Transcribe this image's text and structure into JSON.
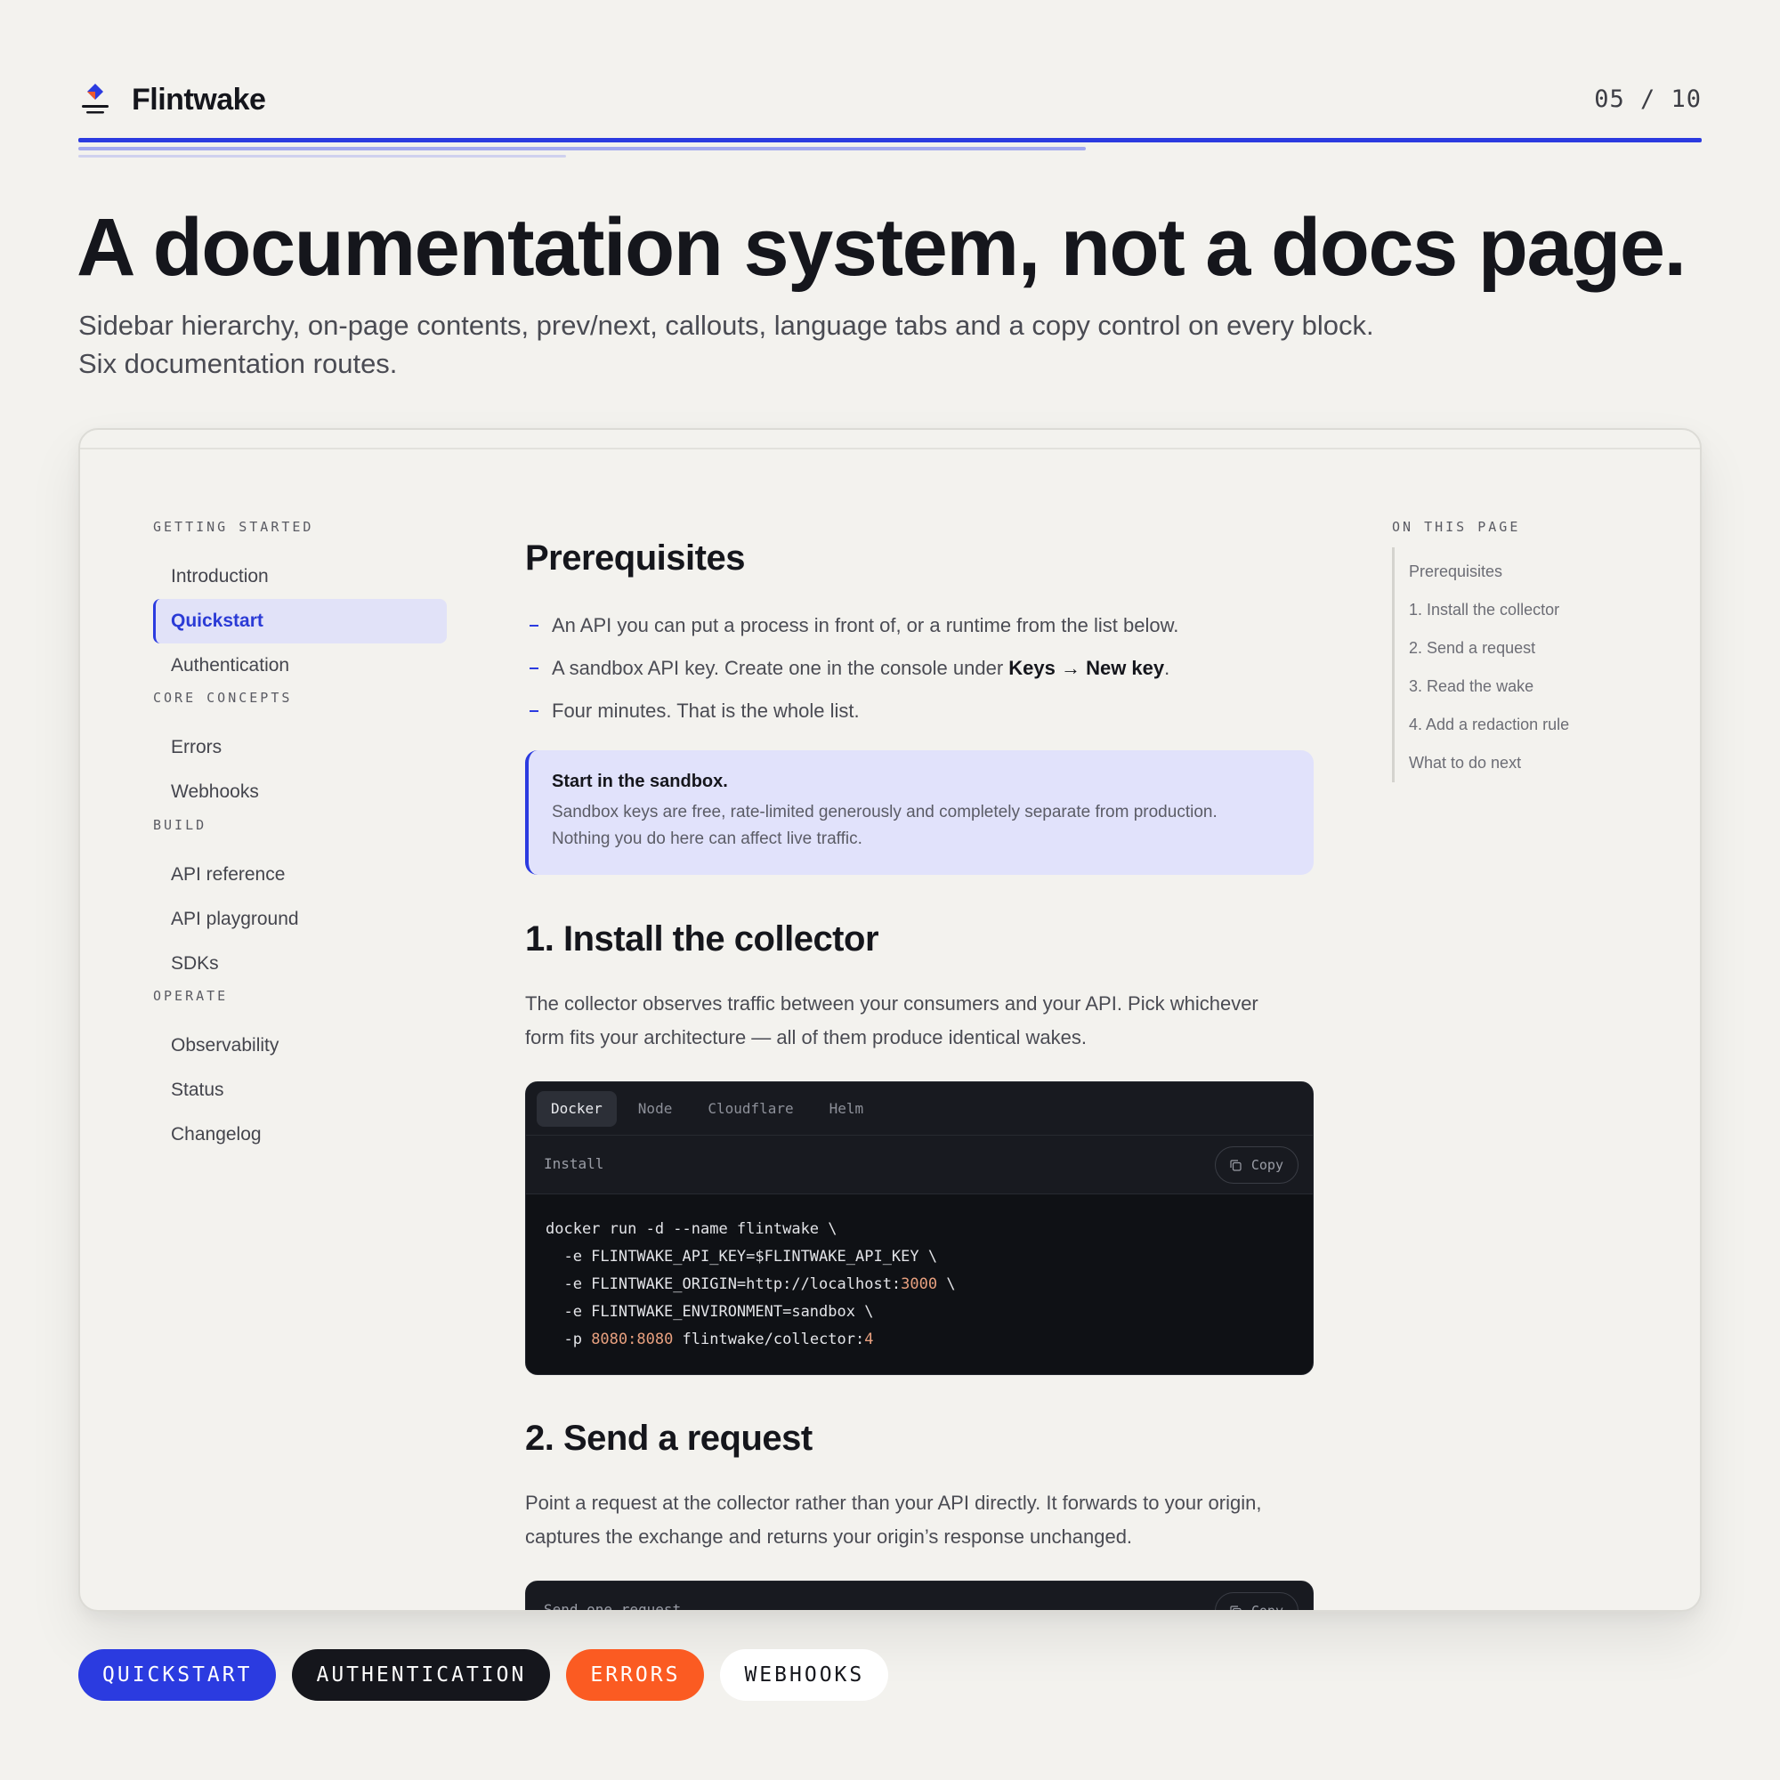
{
  "brand": {
    "name": "Flintwake"
  },
  "pager": "05 / 10",
  "hero": {
    "title": "A documentation system, not a docs page.",
    "subtitle_line1": "Sidebar hierarchy, on-page contents, prev/next, callouts, language tabs and a copy control on every block.",
    "subtitle_line2": "Six documentation routes."
  },
  "sidebar": {
    "groups": [
      {
        "title": "GETTING STARTED",
        "items": [
          "Introduction",
          "Quickstart",
          "Authentication"
        ]
      },
      {
        "title": "CORE CONCEPTS",
        "items": [
          "Errors",
          "Webhooks"
        ]
      },
      {
        "title": "BUILD",
        "items": [
          "API reference",
          "API playground",
          "SDKs"
        ]
      },
      {
        "title": "OPERATE",
        "items": [
          "Observability",
          "Status",
          "Changelog"
        ]
      }
    ],
    "active": "Quickstart"
  },
  "content": {
    "prereq_title": "Prerequisites",
    "bullets": [
      "An API you can put a process in front of, or a runtime from the list below.",
      "A sandbox API key. Create one in the console under ",
      "Four minutes. That is the whole list."
    ],
    "bullet2_strong": "Keys → New key",
    "bullet2_end": ".",
    "callout": {
      "title": "Start in the sandbox.",
      "line1": "Sandbox keys are free, rate-limited generously and completely separate from production.",
      "line2": "Nothing you do here can affect live traffic."
    },
    "step1": {
      "title": "1. Install the collector",
      "line1": "The collector observes traffic between your consumers and your API. Pick whichever",
      "line2": "form fits your architecture — all of them produce identical wakes."
    },
    "code1": {
      "tabs": [
        "Docker",
        "Node",
        "Cloudflare",
        "Helm"
      ],
      "active_tab": "Docker",
      "label": "Install",
      "copy": "Copy",
      "lines": {
        "l1": "docker run -d --name flintwake \\",
        "l2": "  -e FLINTWAKE_API_KEY=$FLINTWAKE_API_KEY \\",
        "l3a": "  -e FLINTWAKE_ORIGIN=http://localhost:",
        "l3num": "3000",
        "l3b": " \\",
        "l4": "  -e FLINTWAKE_ENVIRONMENT=sandbox \\",
        "l5a": "  -p ",
        "l5num": "8080:8080",
        "l5b": " flintwake/collector:",
        "l5num2": "4"
      }
    },
    "step2": {
      "title": "2. Send a request",
      "line1": "Point a request at the collector rather than your API directly. It forwards to your origin,",
      "line2": "captures the exchange and returns your origin’s response unchanged."
    },
    "code2": {
      "label": "Send one request",
      "copy": "Copy"
    }
  },
  "toc": {
    "title": "ON THIS PAGE",
    "items": [
      "Prerequisites",
      "1. Install the collector",
      "2. Send a request",
      "3. Read the wake",
      "4. Add a redaction rule",
      "What to do next"
    ]
  },
  "pills": [
    "QUICKSTART",
    "AUTHENTICATION",
    "ERRORS",
    "WEBHOOKS"
  ],
  "colors": {
    "accent": "#2b3be0",
    "orange": "#fb5b22",
    "ink": "#15161c",
    "background": "#f3f2ee"
  }
}
